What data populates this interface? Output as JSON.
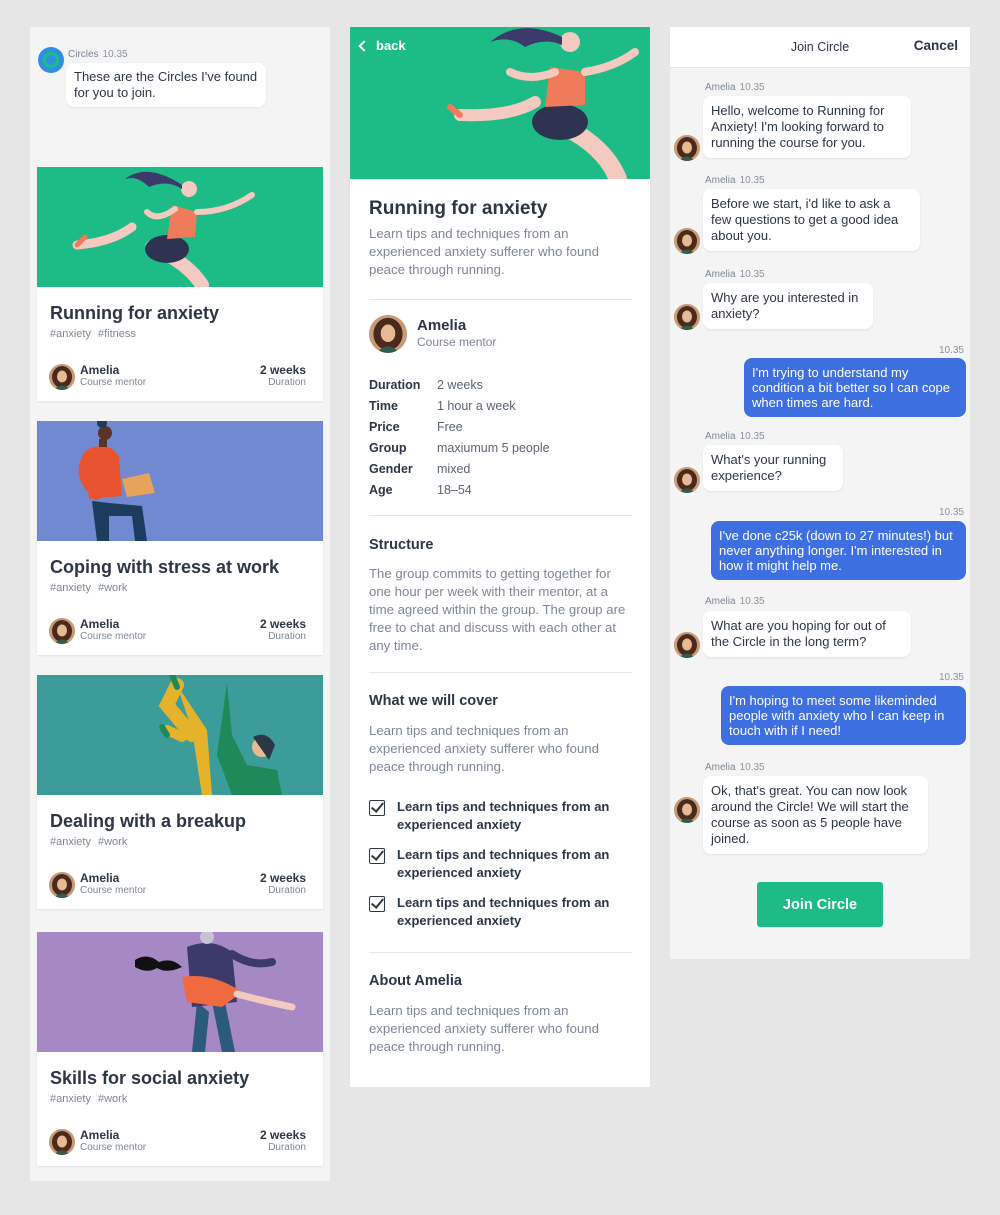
{
  "list": {
    "bot_name": "Circles",
    "bot_time": "10.35",
    "bot_message": "These are the Circles I've found for you to join.",
    "cards": [
      {
        "title": "Running for anxiety",
        "tags": [
          "#anxiety",
          "#fitness"
        ],
        "mentor": "Amelia",
        "role": "Course mentor",
        "duration": "2 weeks",
        "duration_label": "Duration",
        "art_color": "#1dbb85"
      },
      {
        "title": "Coping with stress at work",
        "tags": [
          "#anxiety",
          "#work"
        ],
        "mentor": "Amelia",
        "role": "Course mentor",
        "duration": "2 weeks",
        "duration_label": "Duration",
        "art_color": "#7189d0"
      },
      {
        "title": "Dealing with a breakup",
        "tags": [
          "#anxiety",
          "#work"
        ],
        "mentor": "Amelia",
        "role": "Course mentor",
        "duration": "2 weeks",
        "duration_label": "Duration",
        "art_color": "#3b9c9a"
      },
      {
        "title": "Skills for social anxiety",
        "tags": [
          "#anxiety",
          "#work"
        ],
        "mentor": "Amelia",
        "role": "Course mentor",
        "duration": "2 weeks",
        "duration_label": "Duration",
        "art_color": "#a688c4"
      }
    ]
  },
  "detail": {
    "back_label": "back",
    "title": "Running for anxiety",
    "intro": "Learn tips and techniques from an experienced anxiety sufferer who found peace through running.",
    "mentor_name": "Amelia",
    "mentor_role": "Course mentor",
    "facts": [
      {
        "key": "Duration",
        "value": "2 weeks"
      },
      {
        "key": "Time",
        "value": "1 hour a week"
      },
      {
        "key": "Price",
        "value": "Free"
      },
      {
        "key": "Group",
        "value": "maxiumum 5 people"
      },
      {
        "key": "Gender",
        "value": "mixed"
      },
      {
        "key": "Age",
        "value": "18–54"
      }
    ],
    "structure_heading": "Structure",
    "structure_text": "The group commits to getting together for one hour per week with their mentor, at a time agreed within the group. The group are free to chat and discuss with each other at any time.",
    "cover_heading": "What we will cover",
    "cover_text": "Learn tips and techniques from an experienced anxiety sufferer who found peace through running.",
    "cover_items": [
      "Learn tips and techniques from an experienced anxiety",
      "Learn tips and techniques from an experienced anxiety",
      "Learn tips and techniques from an experienced anxiety"
    ],
    "about_heading": "About Amelia",
    "about_text": "Learn tips and techniques from an experienced anxiety sufferer who found peace through running."
  },
  "chat": {
    "title": "Join Circle",
    "cancel_label": "Cancel",
    "sender": "Amelia",
    "time": "10.35",
    "messages": [
      {
        "from": "Amelia",
        "time": "10.35",
        "text": "Hello, welcome to Running for Anxiety! I'm looking forward to running the course for you."
      },
      {
        "from": "Amelia",
        "time": "10.35",
        "text": "Before we start, i'd like to ask a few questions to get a good idea about you."
      },
      {
        "from": "Amelia",
        "time": "10.35",
        "text": "Why are you interested in anxiety?"
      },
      {
        "from": "me",
        "time": "10.35",
        "text": "I'm trying to understand my condition a bit better so I can cope when times are hard."
      },
      {
        "from": "Amelia",
        "time": "10.35",
        "text": "What's your running experience?"
      },
      {
        "from": "me",
        "time": "10.35",
        "text": "I've done c25k (down to 27 minutes!) but never anything longer. I'm interested in how it might help me."
      },
      {
        "from": "Amelia",
        "time": "10.35",
        "text": "What are you hoping for out of the Circle in the long term?"
      },
      {
        "from": "me",
        "time": "10.35",
        "text": "I'm hoping to meet some likeminded people with anxiety who I can keep in touch with if I need!"
      },
      {
        "from": "Amelia",
        "time": "10.35",
        "text": "Ok, that's great. You can now look around the Circle! We will start the course as soon as 5 people have joined."
      }
    ],
    "join_label": "Join Circle"
  },
  "colors": {
    "green": "#1dbb85",
    "blue": "#3e6fe0",
    "text": "#2c3645",
    "muted": "#7d8795"
  },
  "icons": [
    "circles-logo-icon",
    "back-chevron-icon",
    "checkbox-checked-icon",
    "mentor-avatar"
  ]
}
